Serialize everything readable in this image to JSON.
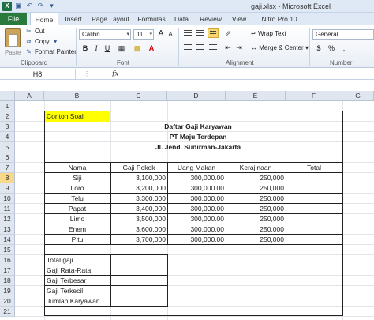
{
  "window": {
    "title": "gaji.xlsx - Microsoft Excel"
  },
  "ribbon": {
    "file_tab": "File",
    "tabs": [
      "Home",
      "Insert",
      "Page Layout",
      "Formulas",
      "Data",
      "Review",
      "View",
      "Nitro Pro 10"
    ],
    "active_tab": "Home",
    "clipboard": {
      "paste": "Paste",
      "cut": "Cut",
      "copy": "Copy",
      "format_painter": "Format Painter",
      "label": "Clipboard"
    },
    "font": {
      "name": "Calibri",
      "size": "11",
      "grow": "A",
      "shrink": "A",
      "bold": "B",
      "italic": "I",
      "underline": "U",
      "label": "Font"
    },
    "alignment": {
      "wrap_text": "Wrap Text",
      "merge_center": "Merge & Center",
      "label": "Alignment"
    },
    "number": {
      "format": "General",
      "label": "Number"
    }
  },
  "formula_bar": {
    "name_box": "H8",
    "fx": "fx"
  },
  "grid": {
    "columns": [
      "A",
      "B",
      "C",
      "D",
      "E",
      "F",
      "G"
    ],
    "rows": [
      "1",
      "2",
      "3",
      "4",
      "5",
      "6",
      "7",
      "8",
      "9",
      "10",
      "11",
      "12",
      "13",
      "14",
      "15",
      "16",
      "17",
      "18",
      "19",
      "20",
      "21"
    ],
    "selected_row": "8"
  },
  "sheet": {
    "example_label": "Contoh Soal",
    "title_lines": [
      "Daftar Gaji Karyawan",
      "PT Maju Terdepan",
      "Jl. Jend. Sudirman-Jakarta"
    ],
    "headers": [
      "Nama",
      "Gaji Pokok",
      "Uang Makan",
      "Kerajinaan",
      "Total"
    ],
    "rows": [
      {
        "nama": "Siji",
        "gaji": "3,100,000",
        "makan": "300,000.00",
        "rajin": "250,000"
      },
      {
        "nama": "Loro",
        "gaji": "3,200,000",
        "makan": "300,000.00",
        "rajin": "250,000"
      },
      {
        "nama": "Telu",
        "gaji": "3,300,000",
        "makan": "300,000.00",
        "rajin": "250,000"
      },
      {
        "nama": "Papat",
        "gaji": "3,400,000",
        "makan": "300,000.00",
        "rajin": "250,000"
      },
      {
        "nama": "Limo",
        "gaji": "3,500,000",
        "makan": "300,000.00",
        "rajin": "250,000"
      },
      {
        "nama": "Enem",
        "gaji": "3,600,000",
        "makan": "300,000.00",
        "rajin": "250,000"
      },
      {
        "nama": "Pitu",
        "gaji": "3,700,000",
        "makan": "300,000.00",
        "rajin": "250,000"
      }
    ],
    "summary": [
      "Total gaji",
      "Gaji Rata-Rata",
      "Gaji Terbesar",
      "Gaji Terkecil",
      "Jumlah Karyawan"
    ]
  }
}
